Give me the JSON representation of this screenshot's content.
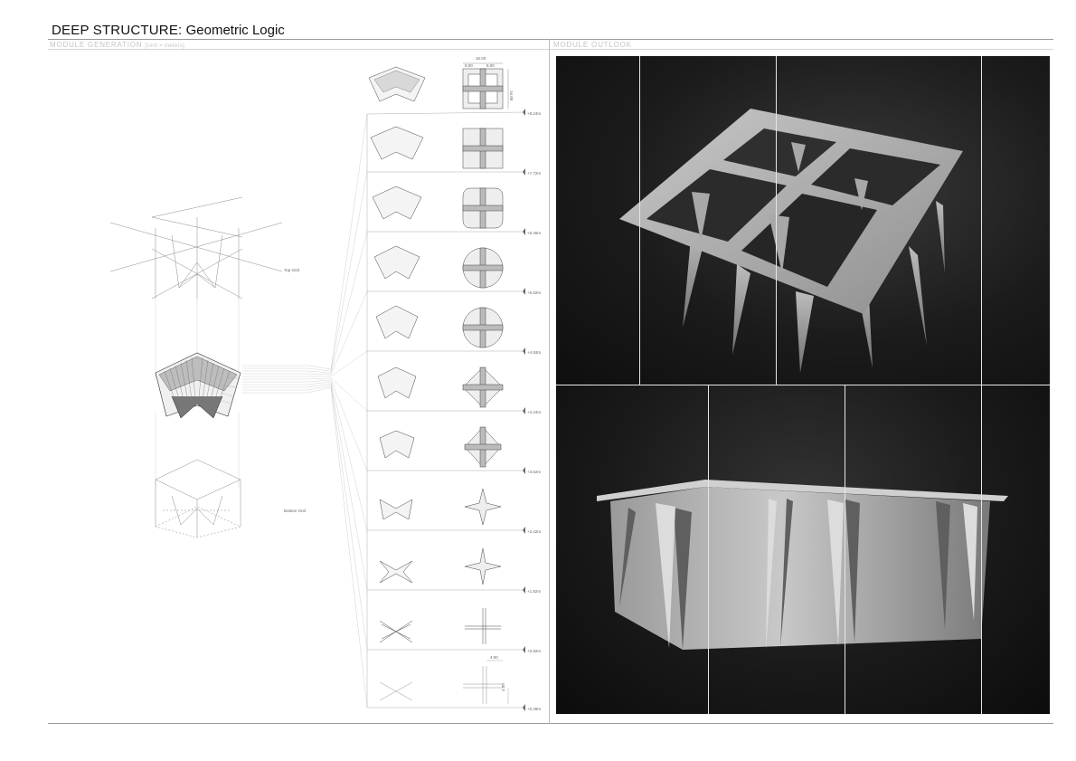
{
  "header": {
    "title_main": "DEEP STRUCTURE:",
    "title_sub": "Geometric Logic"
  },
  "left_section": {
    "label": "MODULE GENERATION",
    "unit_note": "[Unit = meters]",
    "top_grid_label": "Top Grid",
    "bottom_grid_label": "Bottom Grid",
    "top_dimensions": {
      "overall": "16.00",
      "left": "8.00",
      "right": "8.00",
      "side": "16.00"
    },
    "bottom_dimensions": {
      "width": "4.00",
      "height": "4.00"
    },
    "levels": [
      "+8.24m",
      "+7.72m",
      "+6.45m",
      "+5.52m",
      "+4.93m",
      "+4.24m",
      "+3.62m",
      "+2.42m",
      "+1.82m",
      "+0.82m",
      "+0.28m"
    ]
  },
  "right_section": {
    "label": "MODULE OUTLOOK"
  },
  "colors": {
    "photo_background": "#1a1a1a",
    "model": "#cfcfcf",
    "line": "#9a9a9a"
  }
}
